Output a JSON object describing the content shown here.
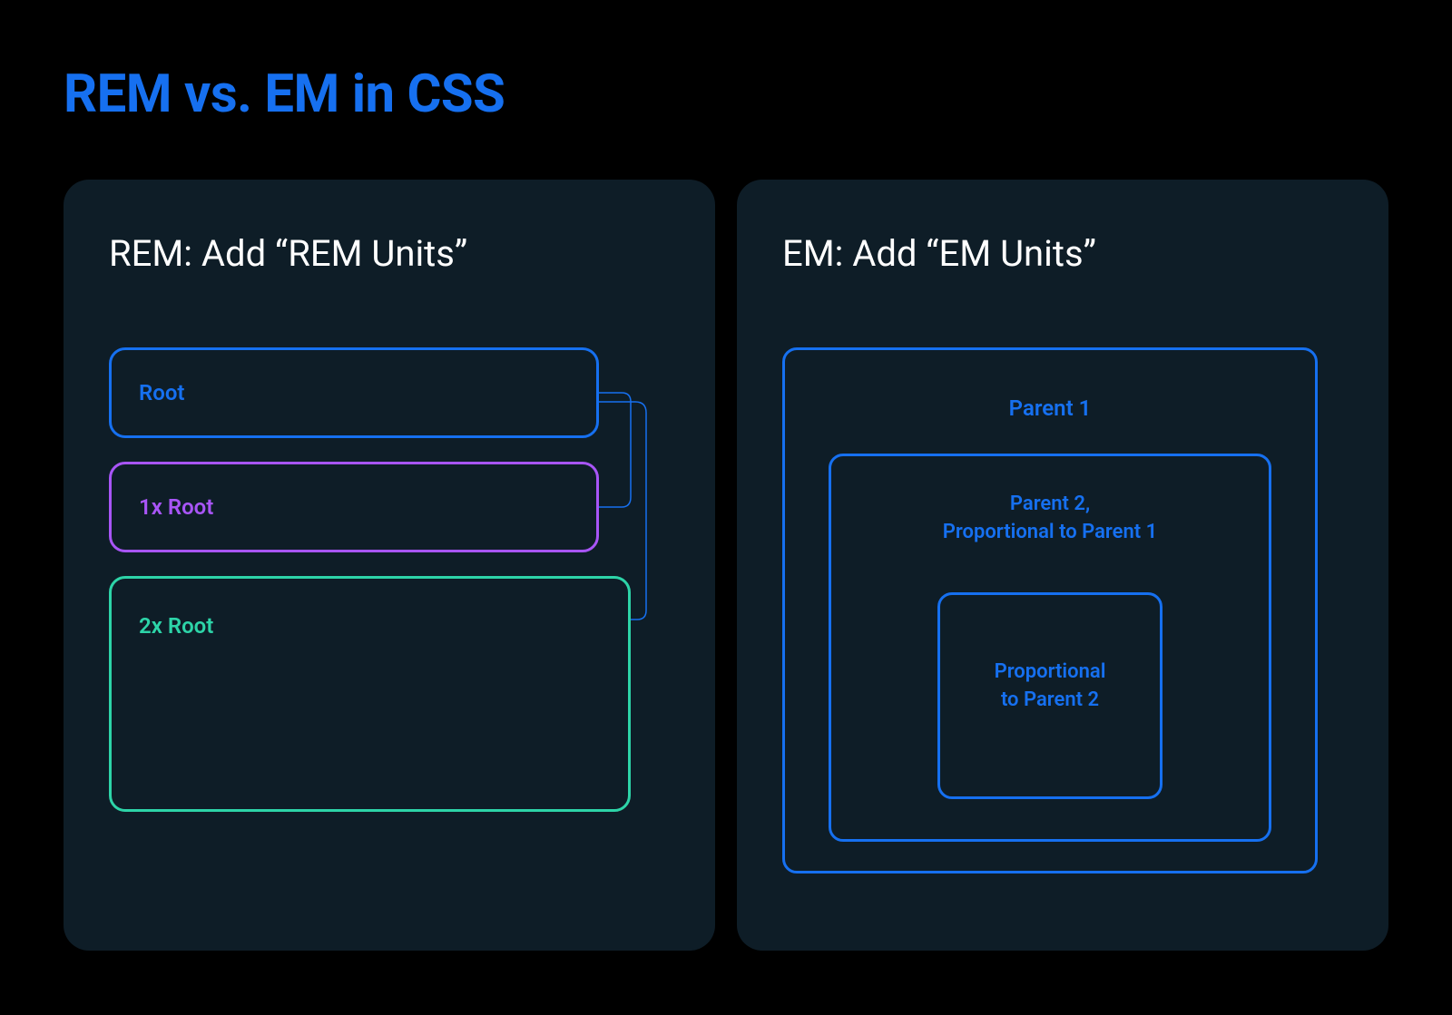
{
  "title": "REM vs. EM in CSS",
  "panels": {
    "rem": {
      "title": "REM: Add “REM Units”",
      "boxes": {
        "root": "Root",
        "oneX": "1x Root",
        "twoX": "2x Root"
      }
    },
    "em": {
      "title": "EM: Add “EM Units”",
      "boxes": {
        "parent1": "Parent 1",
        "parent2_line1": "Parent 2,",
        "parent2_line2": "Proportional to Parent 1",
        "child_line1": "Proportional",
        "child_line2": "to Parent 2"
      }
    }
  },
  "colors": {
    "title_blue": "#1670f0",
    "box_blue": "#1670f0",
    "box_purple": "#a855f7",
    "box_green": "#2dd4a8",
    "panel_bg": "#0e1d27",
    "page_bg": "#000000"
  }
}
